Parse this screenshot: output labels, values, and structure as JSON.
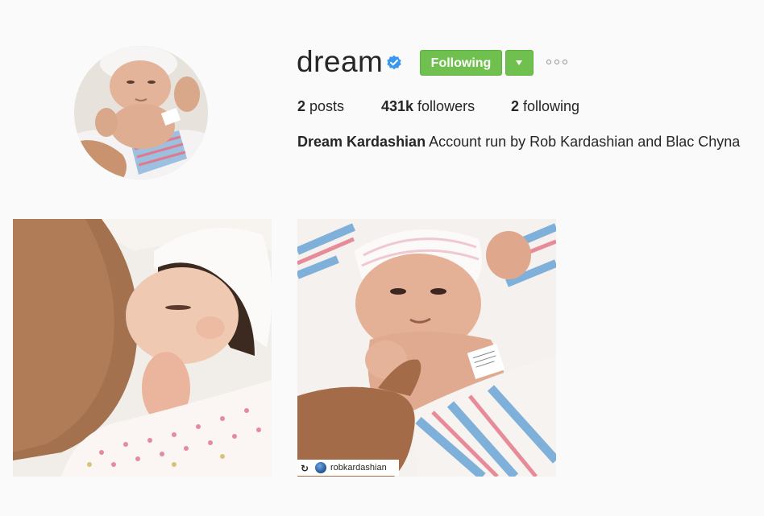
{
  "profile": {
    "username": "dream",
    "verified": true,
    "avatar_alt": "profile-photo-newborn",
    "follow_label": "Following",
    "follow_color": "#70c050",
    "stats": {
      "posts_count": "2",
      "posts_label": " posts",
      "followers_count": "431k",
      "followers_label": " followers",
      "following_count": "2",
      "following_label": " following"
    },
    "bio": {
      "full_name": "Dream Kardashian",
      "text": " Account run by Rob Kardashian and Blac Chyna"
    }
  },
  "posts": [
    {
      "image": "newborn-nursing-photo"
    },
    {
      "image": "newborn-holding-finger-photo",
      "repost_handle": "robkardashian"
    }
  ],
  "icons": {
    "verified": "verified-badge-icon",
    "dropdown": "caret-down-icon",
    "more": "more-options-icon",
    "repost": "repost-icon"
  },
  "colors": {
    "background": "#fafafa",
    "verified_blue": "#3897f0",
    "button_green": "#70c050"
  }
}
